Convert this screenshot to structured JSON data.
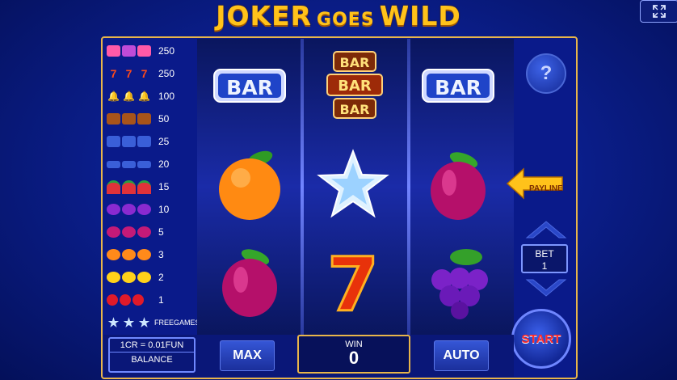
{
  "game": {
    "title_part1": "JOKER",
    "title_part2": "GOES",
    "title_part3": "WILD"
  },
  "colors": {
    "gold": "#ffc21a",
    "frame": "#e8b54a",
    "start_text": "#ff2a2a",
    "background": "#0b1f8f"
  },
  "paytable": [
    {
      "symbol": "mixed-jokers",
      "value": "250"
    },
    {
      "symbol": "seven",
      "value": "250"
    },
    {
      "symbol": "bell",
      "value": "100"
    },
    {
      "symbol": "bar-triple",
      "value": "50"
    },
    {
      "symbol": "bar-double",
      "value": "25"
    },
    {
      "symbol": "bar-single",
      "value": "20"
    },
    {
      "symbol": "watermelon",
      "value": "15"
    },
    {
      "symbol": "grapes",
      "value": "10"
    },
    {
      "symbol": "plum",
      "value": "5"
    },
    {
      "symbol": "orange",
      "value": "3"
    },
    {
      "symbol": "lemon",
      "value": "2"
    },
    {
      "symbol": "cherry",
      "value": "1"
    },
    {
      "symbol": "star",
      "value": "FREEGAMES"
    }
  ],
  "bar_text": "BAR",
  "reels": [
    [
      "bar-single",
      "orange",
      "plum"
    ],
    [
      "bar-triple",
      "star",
      "seven"
    ],
    [
      "bar-single",
      "plum",
      "grapes"
    ]
  ],
  "help_label": "?",
  "payline_label": "PAYLINE",
  "bet": {
    "label": "BET",
    "value": "1"
  },
  "start_label": "START",
  "balance": {
    "rate": "1CR = 0.01FUN",
    "label": "BALANCE"
  },
  "max_label": "MAX",
  "auto_label": "AUTO",
  "win": {
    "label": "WIN",
    "value": "0"
  }
}
